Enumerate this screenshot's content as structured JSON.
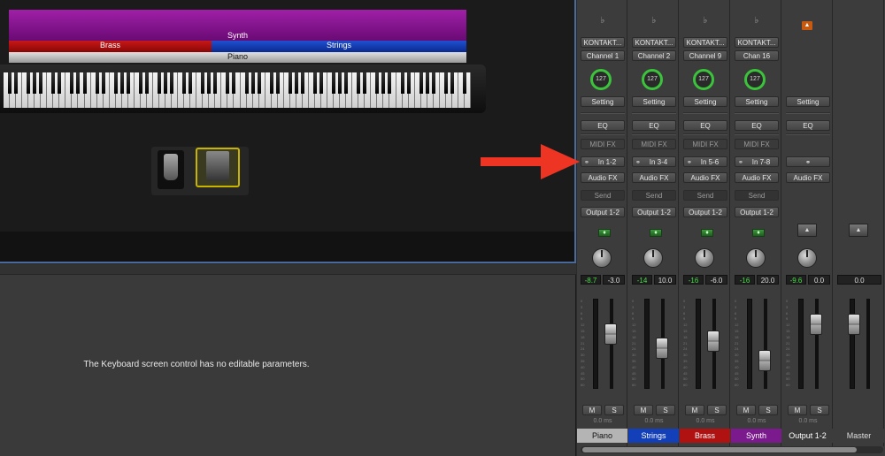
{
  "keyboard": {
    "layers": {
      "synth": "Synth",
      "brass": "Brass",
      "strings": "Strings",
      "piano": "Piano"
    },
    "pedals": [
      "sustain-pedal-icon",
      "expression-pedal-icon"
    ]
  },
  "parameters": {
    "message": "The Keyboard screen control has no editable parameters."
  },
  "mixer": {
    "strips": [
      {
        "plugin": "KONTAKT...",
        "channel": "Channel 1",
        "volume_knob": "127",
        "setting": "Setting",
        "eq": "EQ",
        "midi_fx": "MIDI FX",
        "input": "In 1-2",
        "audio_fx": "Audio FX",
        "send": "Send",
        "output": "Output 1-2",
        "volume_db": "-8.7",
        "peak": "-3.0",
        "mute": "M",
        "solo": "S",
        "delay": "0.0 ms",
        "name": "Piano",
        "color": "#b4b4b4",
        "name_color": "#111111",
        "fader_level": 0.64
      },
      {
        "plugin": "KONTAKT...",
        "channel": "Channel 2",
        "volume_knob": "127",
        "setting": "Setting",
        "eq": "EQ",
        "midi_fx": "MIDI FX",
        "input": "In 3-4",
        "audio_fx": "Audio FX",
        "send": "Send",
        "output": "Output 1-2",
        "volume_db": "-14",
        "peak": "10.0",
        "mute": "M",
        "solo": "S",
        "delay": "0.0 ms",
        "name": "Strings",
        "color": "#1340b8",
        "name_color": "#ffffff",
        "fader_level": 0.44
      },
      {
        "plugin": "KONTAKT...",
        "channel": "Channel 9",
        "volume_knob": "127",
        "setting": "Setting",
        "eq": "EQ",
        "midi_fx": "MIDI FX",
        "input": "In 5-6",
        "audio_fx": "Audio FX",
        "send": "Send",
        "output": "Output 1-2",
        "volume_db": "-16",
        "peak": "-6.0",
        "mute": "M",
        "solo": "S",
        "delay": "0.0 ms",
        "name": "Brass",
        "color": "#b01212",
        "name_color": "#ffffff",
        "fader_level": 0.54
      },
      {
        "plugin": "KONTAKT...",
        "channel": "Chan 16",
        "volume_knob": "127",
        "setting": "Setting",
        "eq": "EQ",
        "midi_fx": "MIDI FX",
        "input": "In 7-8",
        "audio_fx": "Audio FX",
        "send": "Send",
        "output": "Output 1-2",
        "volume_db": "-16",
        "peak": "20.0",
        "mute": "M",
        "solo": "S",
        "delay": "0.0 ms",
        "name": "Synth",
        "color": "#7a1a8c",
        "name_color": "#ffffff",
        "fader_level": 0.26
      },
      {
        "setting": "Setting",
        "eq": "EQ",
        "audio_fx": "Audio FX",
        "volume_db": "-9.6",
        "peak": "0.0",
        "mute": "M",
        "solo": "S",
        "delay": "0.0 ms",
        "name": "Output 1-2",
        "color": "#3c3c3c",
        "name_color": "#ffffff",
        "fader_level": 0.78
      },
      {
        "peak": "0.0",
        "name": "Master",
        "color": "#3c3c3c",
        "name_color": "#dddddd",
        "fader_level": 0.78
      }
    ],
    "meter_scale": [
      "0",
      "3",
      "6",
      "9",
      "12",
      "15",
      "18",
      "21",
      "24",
      "30",
      "35",
      "40",
      "45",
      "50",
      "60"
    ]
  },
  "annotation": {
    "arrow_color": "#ee3524"
  }
}
